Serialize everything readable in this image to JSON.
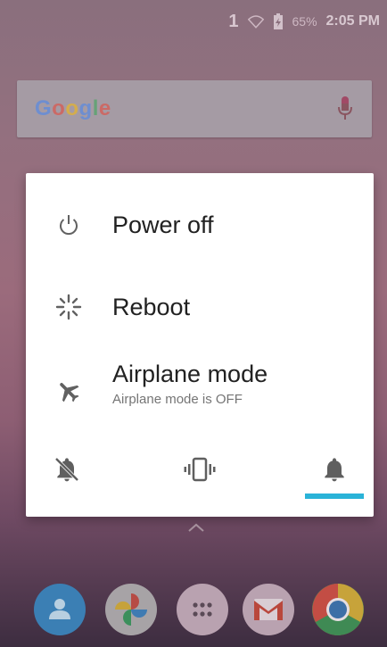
{
  "status_bar": {
    "sim_indicator": "1",
    "battery_percent": "65%",
    "time": "2:05 PM",
    "icons": [
      "wifi-icon",
      "battery-icon"
    ]
  },
  "search_widget": {
    "logo_text": "Google",
    "logo_colors": [
      "#4285f4",
      "#ea4335",
      "#fbbc05",
      "#4285f4",
      "#34a853",
      "#ea4335"
    ],
    "icon": "mic-icon"
  },
  "power_menu": {
    "options": [
      {
        "label": "Power off",
        "icon": "power-icon"
      },
      {
        "label": "Reboot",
        "icon": "reboot-icon"
      },
      {
        "label": "Airplane mode",
        "sublabel": "Airplane mode is OFF",
        "icon": "airplane-icon"
      }
    ],
    "sound_modes": [
      {
        "name": "silent",
        "icon": "bell-off-icon",
        "selected": false
      },
      {
        "name": "vibrate",
        "icon": "vibrate-icon",
        "selected": false
      },
      {
        "name": "sound",
        "icon": "bell-icon",
        "selected": true
      }
    ],
    "accent_color": "#2ab3d8"
  },
  "dock": {
    "apps": [
      {
        "name": "contacts",
        "icon": "contacts-icon",
        "color": "#3b7fb4"
      },
      {
        "name": "photos",
        "icon": "photos-icon",
        "color": "#a7a3a6"
      },
      {
        "name": "app-drawer",
        "icon": "app-drawer-icon",
        "color": "#b9a2b0"
      },
      {
        "name": "gmail",
        "icon": "gmail-icon",
        "color": "#b9a2b0"
      },
      {
        "name": "chrome",
        "icon": "chrome-icon",
        "color": "#c34d44"
      }
    ]
  }
}
